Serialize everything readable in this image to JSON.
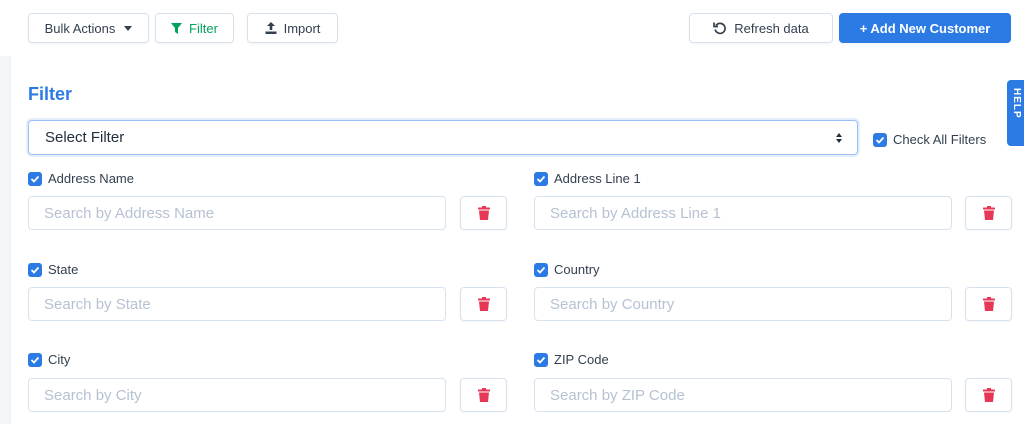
{
  "toolbar": {
    "bulk_actions": "Bulk Actions",
    "filter": "Filter",
    "import": "Import",
    "refresh": "Refresh data",
    "add_customer": "+ Add New Customer"
  },
  "side_tab": "HELP",
  "filter_panel": {
    "title": "Filter",
    "select_value": "Select Filter",
    "check_all_label": "Check All Filters",
    "fields": [
      {
        "label": "Address Name",
        "placeholder": "Search by Address Name",
        "checked": true
      },
      {
        "label": "Address Line 1",
        "placeholder": "Search by Address Line 1",
        "checked": true
      },
      {
        "label": "State",
        "placeholder": "Search by State",
        "checked": true
      },
      {
        "label": "Country",
        "placeholder": "Search by Country",
        "checked": true
      },
      {
        "label": "City",
        "placeholder": "Search by City",
        "checked": true
      },
      {
        "label": "ZIP Code",
        "placeholder": "Search by ZIP Code",
        "checked": true
      }
    ]
  },
  "colors": {
    "primary": "#2c7be5",
    "filter_green": "#00a35c",
    "delete_red": "#e63757"
  },
  "icons": {
    "bulk": "caret-down-icon",
    "filter": "funnel-icon",
    "import": "upload-icon",
    "refresh": "refresh-icon",
    "delete": "trash-icon",
    "check": "checkmark-icon"
  }
}
